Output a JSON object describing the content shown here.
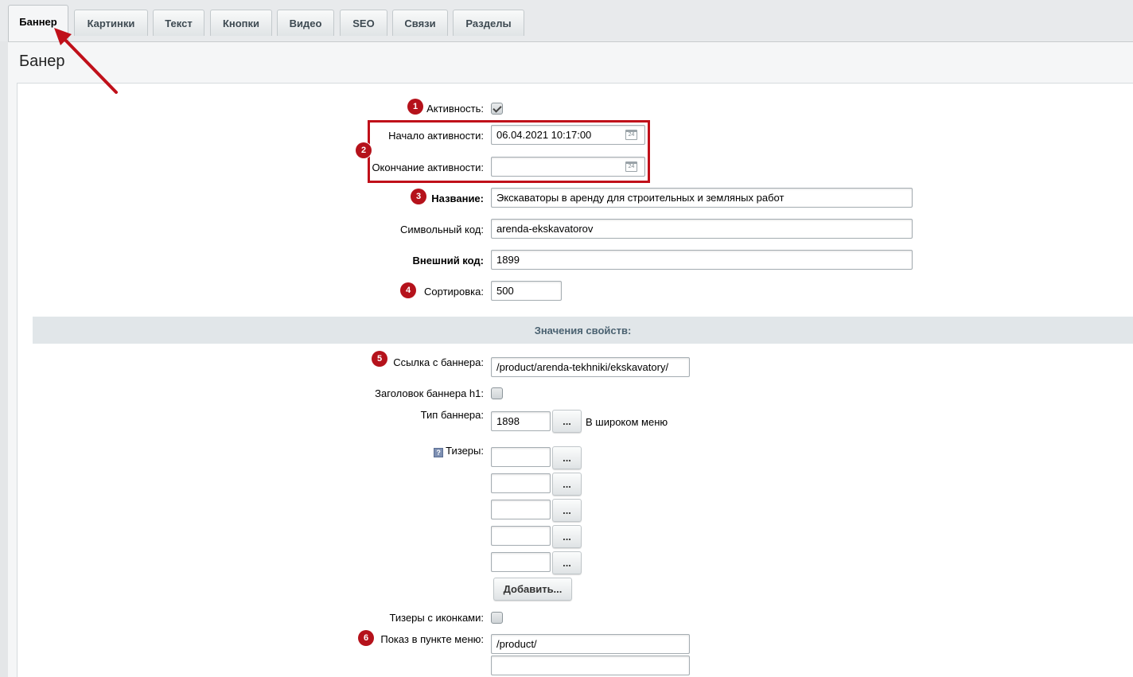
{
  "tabs": [
    {
      "label": "Баннер",
      "active": true
    },
    {
      "label": "Картинки"
    },
    {
      "label": "Текст"
    },
    {
      "label": "Кнопки"
    },
    {
      "label": "Видео"
    },
    {
      "label": "SEO"
    },
    {
      "label": "Связи"
    },
    {
      "label": "Разделы"
    }
  ],
  "page_title": "Банер",
  "form": {
    "active_label": "Активность:",
    "active_checked": true,
    "start_label": "Начало активности:",
    "start_value": "06.04.2021 10:17:00",
    "end_label": "Окончание активности:",
    "end_value": "",
    "calendar_icon_text": "24",
    "name_label": "Название:",
    "name_value": "Экскаваторы в аренду для строительных и земляных работ",
    "code_label": "Символьный код:",
    "code_value": "arenda-ekskavatorov",
    "xml_label": "Внешний код:",
    "xml_value": "1899",
    "sort_label": "Сортировка:",
    "sort_value": "500"
  },
  "props": {
    "header": "Значения свойств:",
    "link_label": "Ссылка с баннера:",
    "link_value": "/product/arenda-tekhniki/ekskavatory/",
    "h1_label": "Заголовок баннера h1:",
    "h1_checked": false,
    "type_label": "Тип баннера:",
    "type_value": "1898",
    "type_button": "...",
    "type_name": "В широком меню",
    "teasers_label": "Тизеры:",
    "teaser_values": [
      "",
      "",
      "",
      "",
      ""
    ],
    "teaser_button": "...",
    "add_button": "Добавить...",
    "teasers_icons_label": "Тизеры с иконками:",
    "teasers_icons_checked": false,
    "menu_label": "Показ в пункте меню:",
    "menu_values": [
      "/product/",
      ""
    ]
  },
  "badges": [
    "1",
    "2",
    "3",
    "4",
    "5",
    "6"
  ],
  "help_icon": "?",
  "colors": {
    "annotation_red": "#b5121b",
    "highlight_border": "#c0101a",
    "section_header_bg": "#e1e6e9"
  }
}
